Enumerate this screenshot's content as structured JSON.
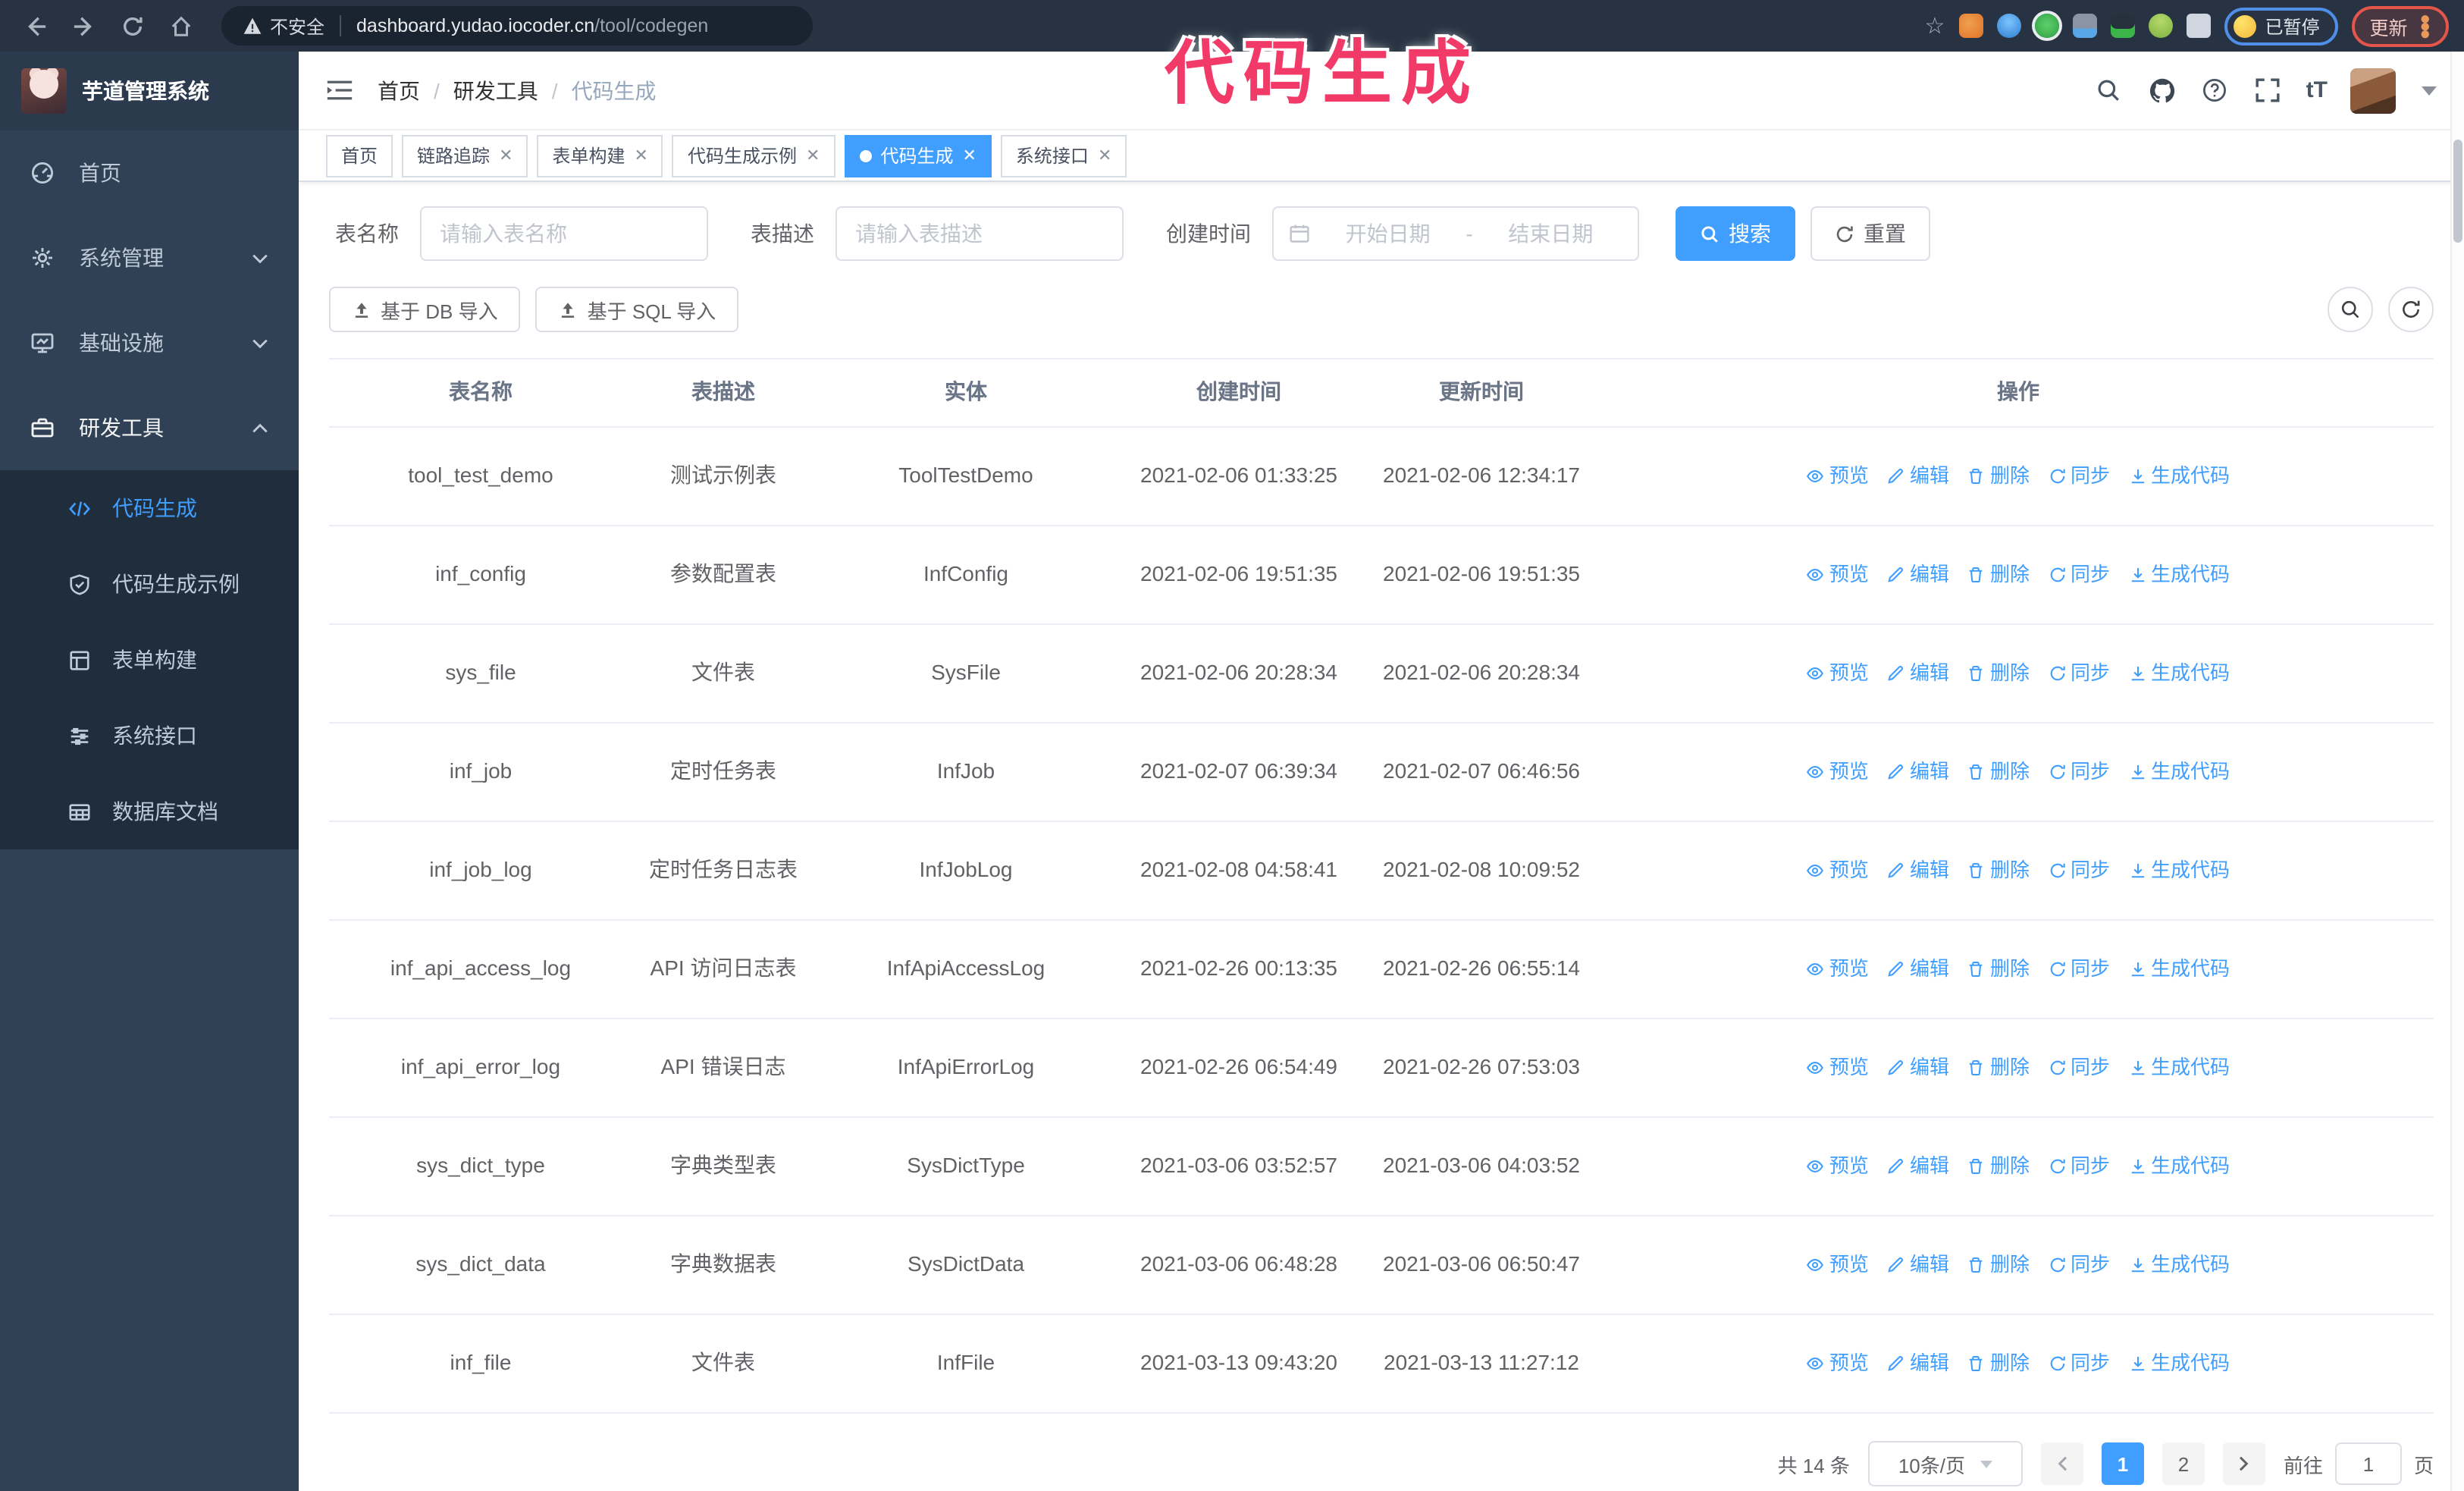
{
  "colors": {
    "accent": "#409eff",
    "sidebar_bg": "#304156",
    "submenu_bg": "#1f2d3d",
    "annotation": "#f23a68",
    "browser_bar_bg": "#273342"
  },
  "browser": {
    "security_label": "不安全",
    "url_host": "dashboard.yudao.iocoder.cn",
    "url_path": "/tool/codegen",
    "paused_badge": "已暂停",
    "update_label": "更新"
  },
  "annotation": {
    "text": "代码生成"
  },
  "app": {
    "title": "芋道管理系统",
    "font_size_icon_text": "tT"
  },
  "breadcrumb": {
    "separator": "/",
    "items": [
      "首页",
      "研发工具",
      "代码生成"
    ]
  },
  "sidebar": {
    "items": [
      {
        "label": "首页"
      },
      {
        "label": "系统管理"
      },
      {
        "label": "基础设施"
      },
      {
        "label": "研发工具"
      }
    ],
    "submenu": [
      {
        "label": "代码生成"
      },
      {
        "label": "代码生成示例"
      },
      {
        "label": "表单构建"
      },
      {
        "label": "系统接口"
      },
      {
        "label": "数据库文档"
      }
    ]
  },
  "tags": [
    {
      "label": "首页"
    },
    {
      "label": "链路追踪"
    },
    {
      "label": "表单构建"
    },
    {
      "label": "代码生成示例"
    },
    {
      "label": "代码生成"
    },
    {
      "label": "系统接口"
    }
  ],
  "filters": {
    "name_label": "表名称",
    "name_placeholder": "请输入表名称",
    "desc_label": "表描述",
    "desc_placeholder": "请输入表描述",
    "time_label": "创建时间",
    "start_placeholder": "开始日期",
    "separator": "-",
    "end_placeholder": "结束日期",
    "search_label": "搜索",
    "reset_label": "重置"
  },
  "import_buttons": [
    {
      "label": "基于 DB 导入"
    },
    {
      "label": "基于 SQL 导入"
    }
  ],
  "table": {
    "columns": [
      "表名称",
      "表描述",
      "实体",
      "创建时间",
      "更新时间",
      "操作"
    ],
    "actions": [
      "预览",
      "编辑",
      "删除",
      "同步",
      "生成代码"
    ],
    "rows": [
      {
        "name": "tool_test_demo",
        "desc": "测试示例表",
        "entity": "ToolTestDemo",
        "created": "2021-02-06 01:33:25",
        "updated": "2021-02-06 12:34:17"
      },
      {
        "name": "inf_config",
        "desc": "参数配置表",
        "entity": "InfConfig",
        "created": "2021-02-06 19:51:35",
        "updated": "2021-02-06 19:51:35"
      },
      {
        "name": "sys_file",
        "desc": "文件表",
        "entity": "SysFile",
        "created": "2021-02-06 20:28:34",
        "updated": "2021-02-06 20:28:34"
      },
      {
        "name": "inf_job",
        "desc": "定时任务表",
        "entity": "InfJob",
        "created": "2021-02-07 06:39:34",
        "updated": "2021-02-07 06:46:56"
      },
      {
        "name": "inf_job_log",
        "desc": "定时任务日志表",
        "entity": "InfJobLog",
        "created": "2021-02-08 04:58:41",
        "updated": "2021-02-08 10:09:52"
      },
      {
        "name": "inf_api_access_log",
        "desc": "API 访问日志表",
        "entity": "InfApiAccessLog",
        "created": "2021-02-26 00:13:35",
        "updated": "2021-02-26 06:55:14"
      },
      {
        "name": "inf_api_error_log",
        "desc": "API 错误日志",
        "entity": "InfApiErrorLog",
        "created": "2021-02-26 06:54:49",
        "updated": "2021-02-26 07:53:03"
      },
      {
        "name": "sys_dict_type",
        "desc": "字典类型表",
        "entity": "SysDictType",
        "created": "2021-03-06 03:52:57",
        "updated": "2021-03-06 04:03:52"
      },
      {
        "name": "sys_dict_data",
        "desc": "字典数据表",
        "entity": "SysDictData",
        "created": "2021-03-06 06:48:28",
        "updated": "2021-03-06 06:50:47"
      },
      {
        "name": "inf_file",
        "desc": "文件表",
        "entity": "InfFile",
        "created": "2021-03-13 09:43:20",
        "updated": "2021-03-13 11:27:12"
      }
    ]
  },
  "pagination": {
    "total": "共 14 条",
    "page_size": "10条/页",
    "pages": [
      "1",
      "2"
    ],
    "active_page": "1",
    "goto_label": "前往",
    "goto_value": "1",
    "unit": "页"
  }
}
